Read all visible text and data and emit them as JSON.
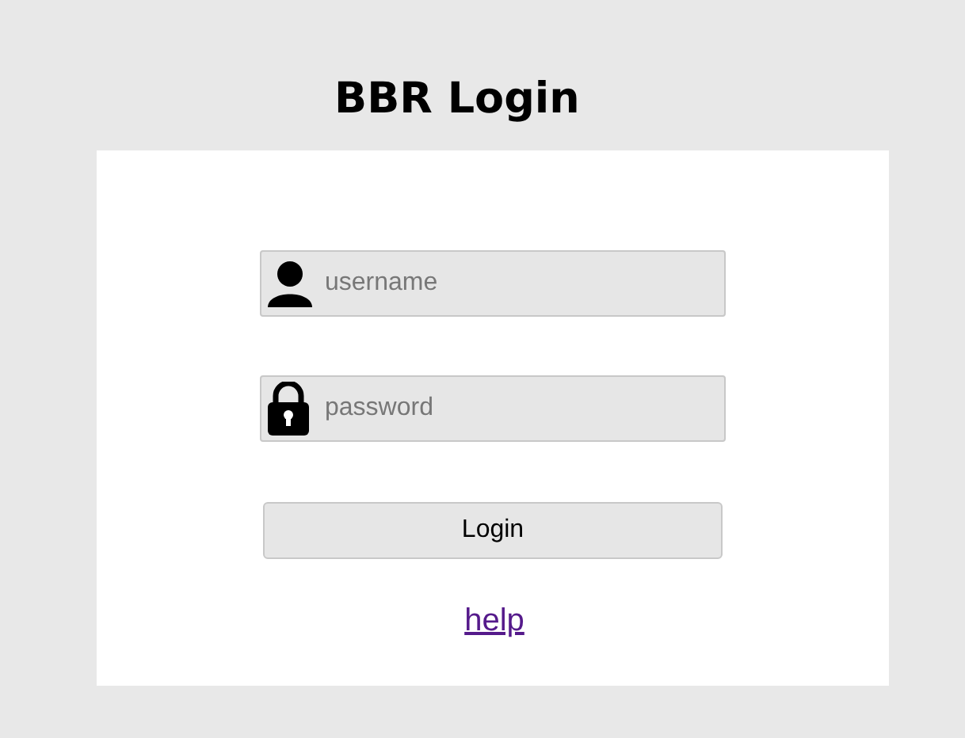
{
  "title": "BBR Login",
  "fields": [
    {
      "kind": "user",
      "placeholder": "username"
    },
    {
      "kind": "lock",
      "placeholder": "password"
    }
  ],
  "login_button": "Login",
  "help_link": "help"
}
